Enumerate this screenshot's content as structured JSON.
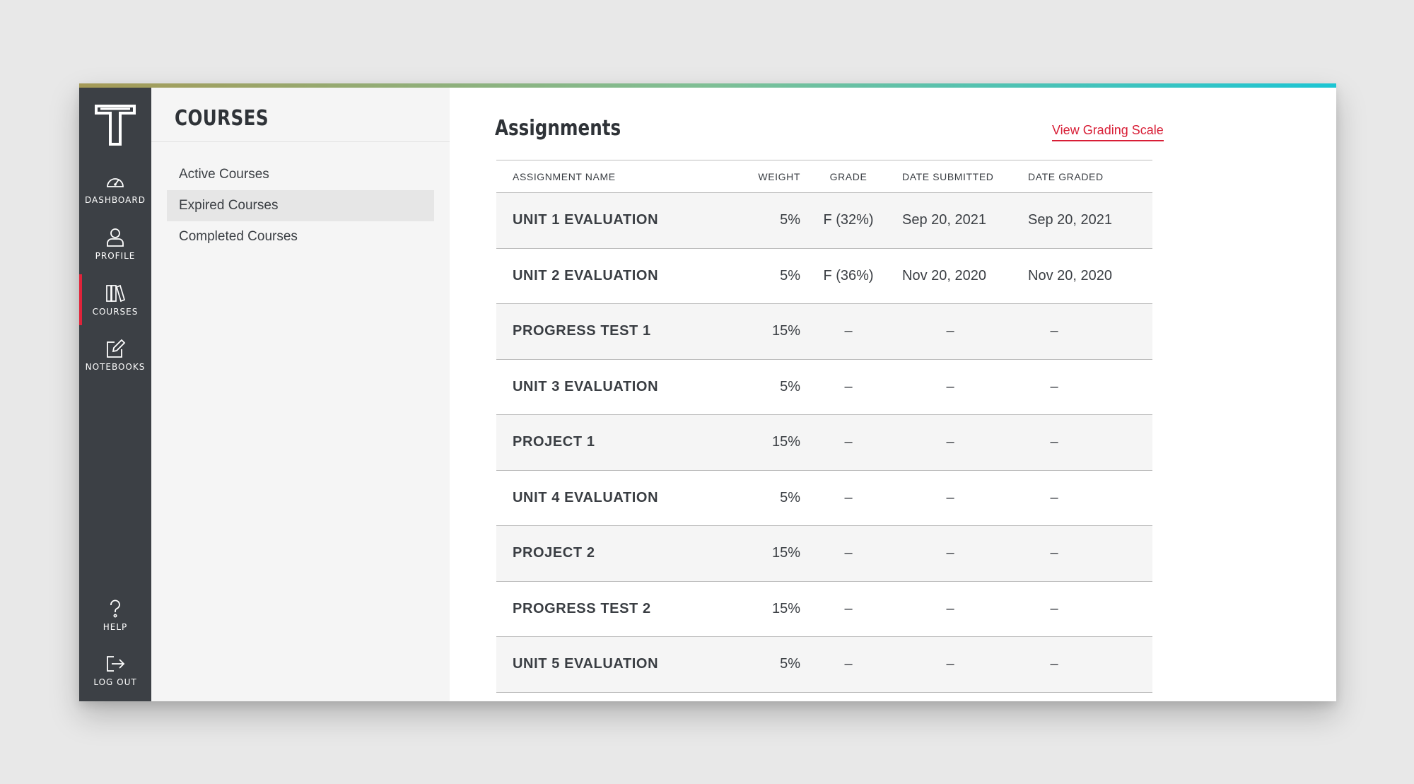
{
  "rail": {
    "items": [
      {
        "label": "DASHBOARD",
        "icon": "dashboard-gauge-icon"
      },
      {
        "label": "PROFILE",
        "icon": "person-icon"
      },
      {
        "label": "COURSES",
        "icon": "books-icon"
      },
      {
        "label": "NOTEBOOKS",
        "icon": "pencil-edit-icon"
      }
    ],
    "bottom_items": [
      {
        "label": "HELP",
        "icon": "help-question-icon"
      },
      {
        "label": "LOG OUT",
        "icon": "logout-icon"
      }
    ],
    "active_color": "#e0233a"
  },
  "subnav": {
    "title": "COURSES",
    "items": [
      {
        "label": "Active Courses"
      },
      {
        "label": "Expired Courses"
      },
      {
        "label": "Completed Courses"
      }
    ],
    "selected": "Expired Courses"
  },
  "main": {
    "title": "Assignments",
    "grading_link": "View Grading Scale",
    "columns": {
      "name": "ASSIGNMENT NAME",
      "weight": "WEIGHT",
      "grade": "GRADE",
      "submitted": "DATE SUBMITTED",
      "graded": "DATE GRADED"
    },
    "rows": [
      {
        "name": "UNIT 1 EVALUATION",
        "weight": "5%",
        "grade": "F (32%)",
        "submitted": "Sep 20, 2021",
        "graded": "Sep 20, 2021"
      },
      {
        "name": "UNIT 2 EVALUATION",
        "weight": "5%",
        "grade": "F (36%)",
        "submitted": "Nov 20, 2020",
        "graded": "Nov 20, 2020"
      },
      {
        "name": "PROGRESS TEST 1",
        "weight": "15%",
        "grade": "–",
        "submitted": "–",
        "graded": "–"
      },
      {
        "name": "UNIT 3 EVALUATION",
        "weight": "5%",
        "grade": "–",
        "submitted": "–",
        "graded": "–"
      },
      {
        "name": "PROJECT 1",
        "weight": "15%",
        "grade": "–",
        "submitted": "–",
        "graded": "–"
      },
      {
        "name": "UNIT 4 EVALUATION",
        "weight": "5%",
        "grade": "–",
        "submitted": "–",
        "graded": "–"
      },
      {
        "name": "PROJECT 2",
        "weight": "15%",
        "grade": "–",
        "submitted": "–",
        "graded": "–"
      },
      {
        "name": "PROGRESS TEST 2",
        "weight": "15%",
        "grade": "–",
        "submitted": "–",
        "graded": "–"
      },
      {
        "name": "UNIT 5 EVALUATION",
        "weight": "5%",
        "grade": "–",
        "submitted": "–",
        "graded": "–"
      }
    ]
  },
  "colors": {
    "rail": "#3c4045",
    "accent_red": "#d81e36",
    "gradient_start": "#a59a57",
    "gradient_end": "#1cc5d3"
  }
}
